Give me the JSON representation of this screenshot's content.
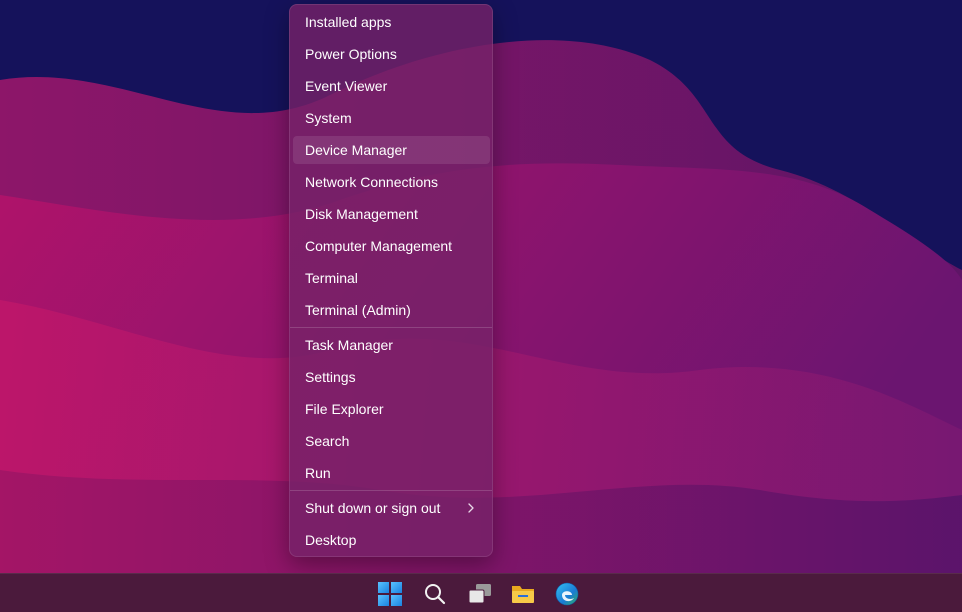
{
  "context_menu": {
    "items": [
      {
        "label": "Installed apps"
      },
      {
        "label": "Power Options"
      },
      {
        "label": "Event Viewer"
      },
      {
        "label": "System"
      },
      {
        "label": "Device Manager"
      },
      {
        "label": "Network Connections"
      },
      {
        "label": "Disk Management"
      },
      {
        "label": "Computer Management"
      },
      {
        "label": "Terminal"
      },
      {
        "label": "Terminal (Admin)"
      },
      {
        "label": "Task Manager"
      },
      {
        "label": "Settings"
      },
      {
        "label": "File Explorer"
      },
      {
        "label": "Search"
      },
      {
        "label": "Run"
      },
      {
        "label": "Shut down or sign out"
      },
      {
        "label": "Desktop"
      }
    ],
    "highlighted_item": "Device Manager"
  },
  "taskbar": {
    "icons": [
      "windows-start-icon",
      "search-icon",
      "task-view-icon",
      "file-explorer-icon",
      "edge-browser-icon"
    ]
  },
  "colors": {
    "wallpaper_top": "#14115a",
    "wallpaper_magenta": "#a3145f",
    "wallpaper_purple": "#6d1a72",
    "taskbar": "#4b1a3c",
    "windows_blue": "#3aa0f0",
    "folder_yellow": "#f5c242"
  }
}
